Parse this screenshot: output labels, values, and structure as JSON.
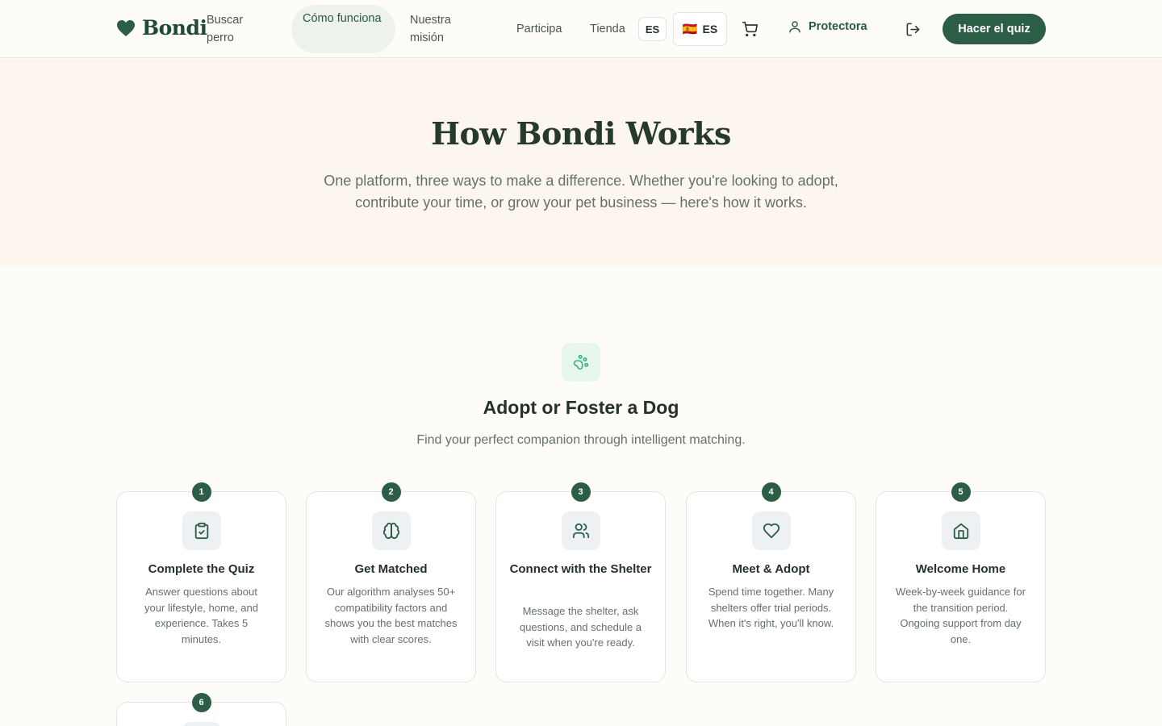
{
  "brand": {
    "name": "Bondi"
  },
  "nav": {
    "items": [
      {
        "label": "Buscar perro"
      },
      {
        "label": "Cómo funciona"
      },
      {
        "label": "Nuestra misión"
      },
      {
        "label": "Participa"
      },
      {
        "label": "Tienda"
      }
    ],
    "lang_code": "ES",
    "lang_selector": {
      "flag": "🇪🇸",
      "label": "ES"
    },
    "account_label": "Protectora",
    "cta_label": "Hacer el quiz"
  },
  "hero": {
    "title": "How Bondi Works",
    "subtitle": "One platform, three ways to make a difference. Whether you're looking to adopt, contribute your time, or grow your pet business — here's how it works."
  },
  "section": {
    "icon": "paw-icon",
    "title": "Adopt or Foster a Dog",
    "subtitle": "Find your perfect companion through intelligent matching."
  },
  "steps": [
    {
      "num": "1",
      "icon": "clipboard-check-icon",
      "title": "Complete the Quiz",
      "desc": "Answer questions about your lifestyle, home, and experience. Takes 5 minutes."
    },
    {
      "num": "2",
      "icon": "brain-icon",
      "title": "Get Matched",
      "desc": "Our algorithm analyses 50+ compatibility factors and shows you the best matches with clear scores."
    },
    {
      "num": "3",
      "icon": "users-icon",
      "title": "Connect with the Shelter",
      "desc": "Message the shelter, ask questions, and schedule a visit when you're ready."
    },
    {
      "num": "4",
      "icon": "heart-icon",
      "title": "Meet & Adopt",
      "desc": "Spend time together. Many shelters offer trial periods. When it's right, you'll know."
    },
    {
      "num": "5",
      "icon": "home-icon",
      "title": "Welcome Home",
      "desc": "Week-by-week guidance for the transition period. Ongoing support from day one."
    },
    {
      "num": "6"
    }
  ],
  "colors": {
    "brand": "#2c5e45",
    "hero_bg": "#fdf6ee",
    "accent_icon": "#34b87a"
  }
}
